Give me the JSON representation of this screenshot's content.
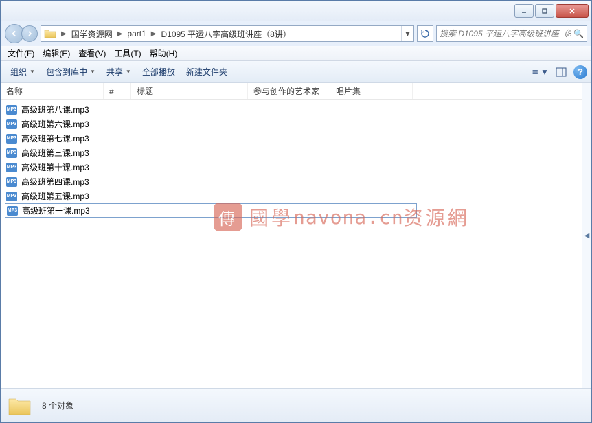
{
  "breadcrumb": {
    "items": [
      "国学资源网",
      "part1",
      "D1095 平运八字高级班讲座（8讲）"
    ]
  },
  "search": {
    "placeholder": "搜索 D1095 平运八字高级班讲座（8..."
  },
  "menu": {
    "file": "文件(F)",
    "edit": "编辑(E)",
    "view": "查看(V)",
    "tools": "工具(T)",
    "help": "帮助(H)"
  },
  "toolbar": {
    "organize": "组织",
    "include": "包含到库中",
    "share": "共享",
    "playall": "全部播放",
    "newfolder": "新建文件夹"
  },
  "columns": {
    "name": "名称",
    "num": "#",
    "title": "标题",
    "artist": "参与创作的艺术家",
    "album": "唱片集"
  },
  "files": [
    {
      "name": "高级班第八课.mp3",
      "selected": false
    },
    {
      "name": "高级班第六课.mp3",
      "selected": false
    },
    {
      "name": "高级班第七课.mp3",
      "selected": false
    },
    {
      "name": "高级班第三课.mp3",
      "selected": false
    },
    {
      "name": "高级班第十课.mp3",
      "selected": false
    },
    {
      "name": "高级班第四课.mp3",
      "selected": false
    },
    {
      "name": "高级班第五课.mp3",
      "selected": false
    },
    {
      "name": "高级班第一课.mp3",
      "selected": true
    }
  ],
  "status": {
    "text": "8 个对象"
  },
  "watermark": {
    "badge": "傳",
    "text1": "國學",
    "url": "navona.cn",
    "text2": "资源網"
  },
  "icons": {
    "mp3": "MP3"
  }
}
